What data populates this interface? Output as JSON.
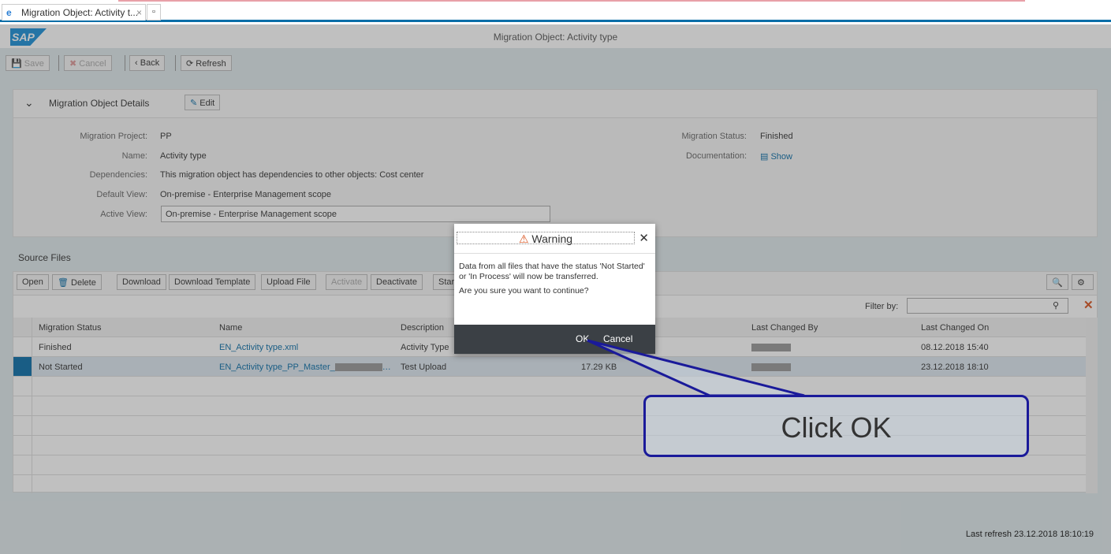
{
  "browser": {
    "tab_title": "Migration Object: Activity t...",
    "close": "×"
  },
  "shell": {
    "logo": "SAP",
    "title": "Migration Object: Activity type"
  },
  "toolbar": {
    "save": "Save",
    "cancel": "Cancel",
    "back": "Back",
    "refresh": "Refresh"
  },
  "details": {
    "header": "Migration Object Details",
    "edit": "Edit",
    "fields": [
      {
        "label": "Migration Project:",
        "value": "PP"
      },
      {
        "label": "Name:",
        "value": "Activity type"
      },
      {
        "label": "Dependencies:",
        "value": "This migration object has dependencies to other objects: Cost center"
      },
      {
        "label": "Default View:",
        "value": "On-premise - Enterprise Management scope"
      },
      {
        "label": "Active View:",
        "value": "On-premise - Enterprise Management scope"
      }
    ],
    "status_label": "Migration Status:",
    "status_value": "Finished",
    "doc_label": "Documentation:",
    "doc_link": "Show"
  },
  "source_files": {
    "title": "Source Files",
    "buttons": {
      "open": "Open",
      "delete": "Delete",
      "download": "Download",
      "download_template": "Download Template",
      "upload": "Upload File",
      "activate": "Activate",
      "deactivate": "Deactivate",
      "start": "Star"
    },
    "filter_label": "Filter by:",
    "filter_value": "",
    "columns": [
      "Migration Status",
      "Name",
      "Description",
      "Last Changed By",
      "Last Changed On"
    ],
    "rows": [
      {
        "status": "Finished",
        "name": "EN_Activity type.xml",
        "description": "Activity Type",
        "size": "",
        "changed_on": "08.12.2018 15:40"
      },
      {
        "status": "Not Started",
        "name": "EN_Activity type_PP_Master_",
        "description": "Test Upload",
        "size": "17.29 KB",
        "changed_on": "23.12.2018 18:10"
      }
    ]
  },
  "dialog": {
    "title": "Warning",
    "line1": "Data from all files that have the status 'Not Started' or 'In Process' will now be transferred.",
    "line2": "Are you sure you want to continue?",
    "ok": "OK",
    "cancel": "Cancel"
  },
  "callout": {
    "text": "Click OK"
  },
  "footer": {
    "last_refresh": "Last refresh 23.12.2018 18:10:19"
  },
  "colors": {
    "accent": "#0a6ea8",
    "dialog_footer": "#3b4045",
    "callout_border": "#1a1a9a"
  }
}
